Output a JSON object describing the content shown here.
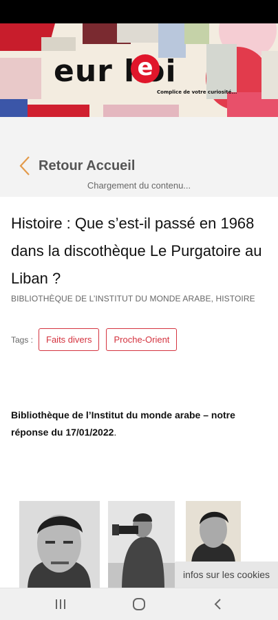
{
  "header": {
    "logo_text": "eur  koi",
    "logo_mark": "e",
    "tagline": "Complice de votre curiosité..."
  },
  "nav": {
    "back_label": "Retour Accueil",
    "loading_text": "Chargement du contenu..."
  },
  "article": {
    "title": "Histoire : Que s’est-il passé en 1968 dans la discothèque Le Purgatoire au Liban ?",
    "source": "BIBLIOTHÈQUE DE L’INSTITUT DU MONDE ARABE, HISTOIRE",
    "tags_label": "Tags :",
    "tags": [
      "Faits divers",
      "Proche-Orient"
    ],
    "answer_bold": "Bibliothèque de l’Institut du monde arabe – notre réponse du 17/01/2022",
    "answer_tail": "."
  },
  "cookie": {
    "label": "infos sur les cookies"
  },
  "icons": {
    "back": "chevron-left-icon",
    "recents": "recent-apps-icon",
    "home": "home-icon",
    "system_back": "system-back-icon"
  },
  "colors": {
    "accent": "#d4323e",
    "back_chevron": "#e39a4a",
    "logo_red": "#e0162b"
  }
}
